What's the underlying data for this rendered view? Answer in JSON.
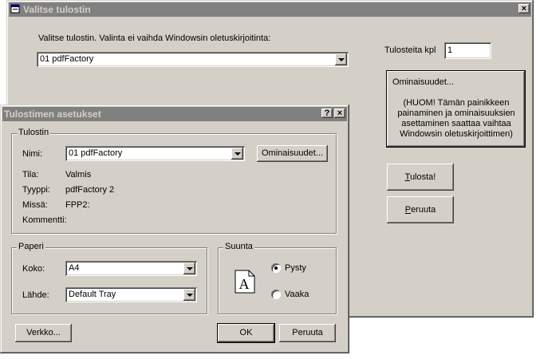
{
  "main_dialog": {
    "title": "Valitse tulostin",
    "close_glyph": "×",
    "instruction": "Valitse tulostin. Valinta ei vaihda Windowsin oletuskirjoitinta:",
    "printer_selected": "01 pdfFactory",
    "copies_label": "Tulosteita kpl",
    "copies_value": "1",
    "properties_button": {
      "title": "Ominaisuudet...",
      "note": "(HUOM! Tämän painikkeen painaminen ja ominaisuuksien asettaminen saattaa vaihtaa Windowsin oletuskirjoittimen)"
    },
    "print_button": {
      "underlined": "T",
      "rest": "ulosta!"
    },
    "cancel_button": {
      "underlined": "P",
      "rest": "eruuta"
    }
  },
  "setup_dialog": {
    "title": "Tulostimen asetukset",
    "help_glyph": "?",
    "close_glyph": "×",
    "printer_group": {
      "title": "Tulostin",
      "name_label": "Nimi:",
      "name_value": "01 pdfFactory",
      "properties_button": "Ominaisuudet...",
      "status_label": "Tila:",
      "status_value": "Valmis",
      "type_label": "Tyyppi:",
      "type_value": "pdfFactory 2",
      "where_label": "Missä:",
      "where_value": "FPP2:",
      "comment_label": "Kommentti:",
      "comment_value": ""
    },
    "paper_group": {
      "title": "Paperi",
      "size_label": "Koko:",
      "size_value": "A4",
      "source_label": "Lähde:",
      "source_value": "Default Tray"
    },
    "orientation_group": {
      "title": "Suunta",
      "portrait_icon_letter": "A",
      "portrait_label": "Pysty",
      "landscape_label": "Vaaka",
      "selected": "Pysty"
    },
    "network_button": "Verkko...",
    "ok_button": "OK",
    "cancel_button": "Peruuta"
  },
  "colors": {
    "face": "#d4d0c8",
    "inactive_titlebar": "#808080",
    "inactive_title_text": "#d4d0c8"
  }
}
